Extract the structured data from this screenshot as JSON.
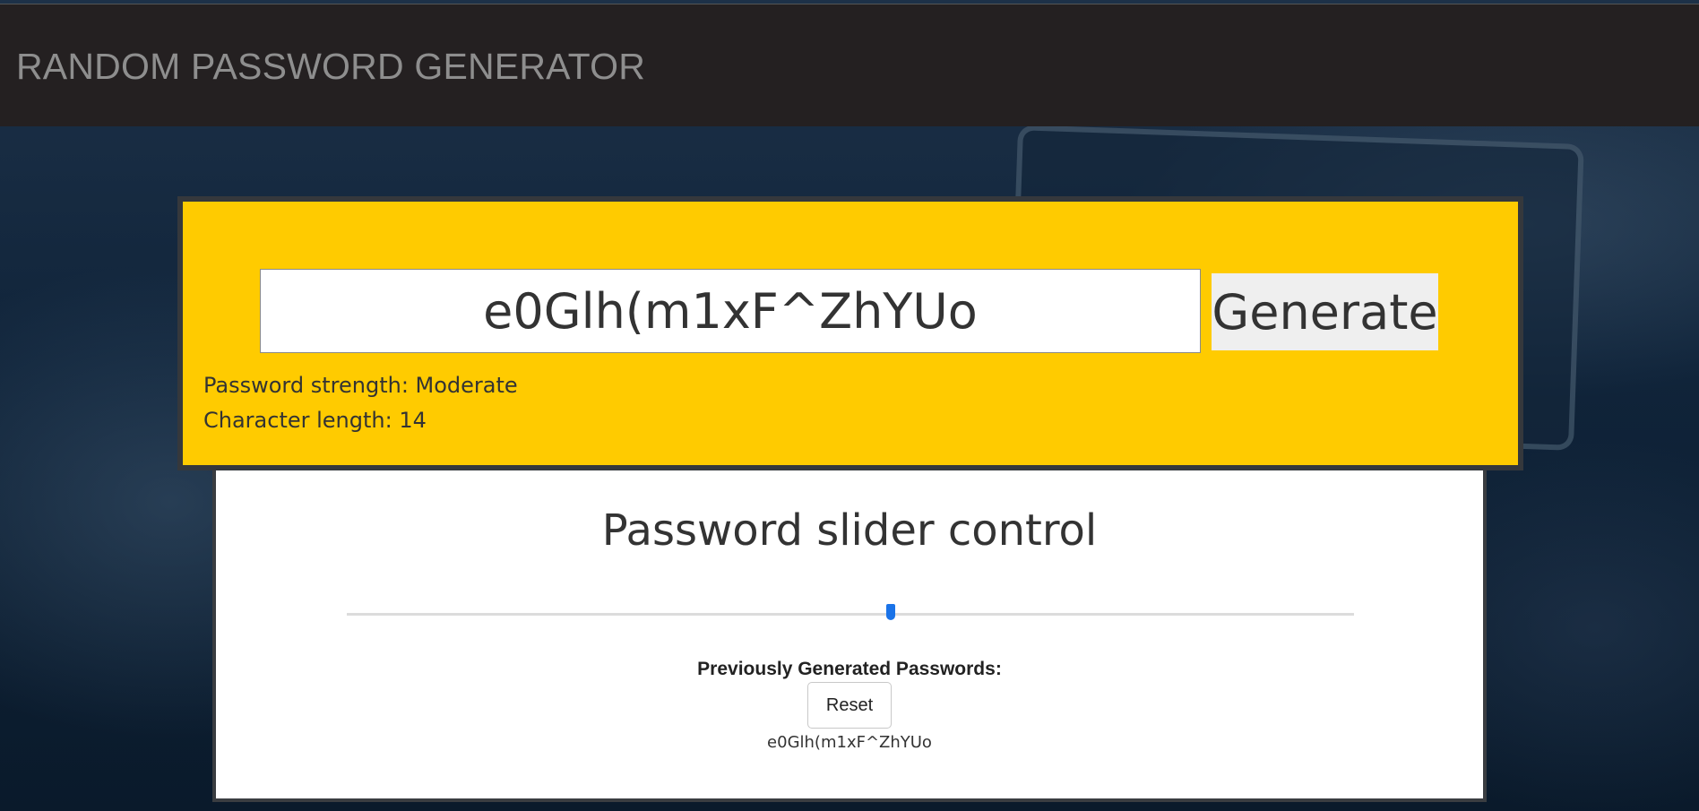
{
  "header": {
    "title": "RANDOM PASSWORD GENERATOR"
  },
  "generator": {
    "password": "e0Glh(m1xF^ZhYUo",
    "generate_label": "Generate",
    "strength_text": "Password strength: Moderate",
    "length_text": "Character length: 14"
  },
  "slider": {
    "heading": "Password slider control",
    "level_fraction": 0.54
  },
  "history": {
    "label": "Previously Generated Passwords:",
    "reset_label": "Reset",
    "items": [
      "e0Glh(m1xF^ZhYUo"
    ]
  },
  "colors": {
    "header_bg": "#242021",
    "generator_bg": "#ffcb00",
    "slider_thumb": "#1a73e8"
  }
}
